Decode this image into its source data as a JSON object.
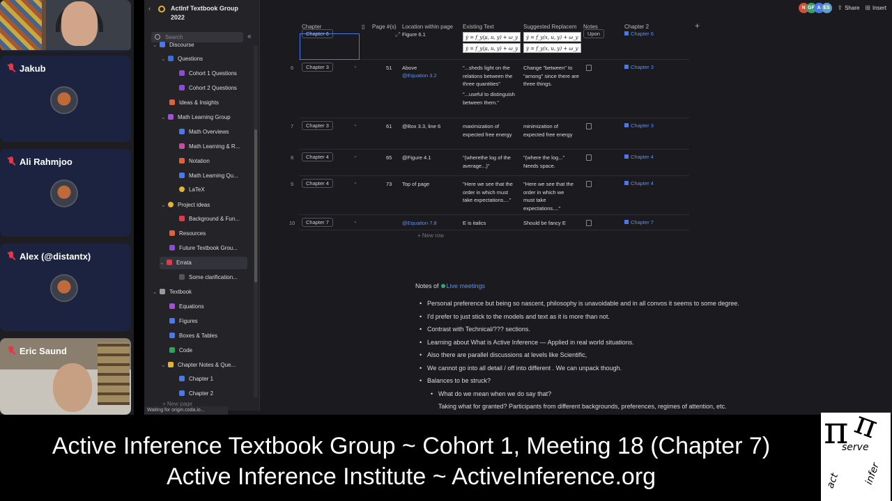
{
  "participants": [
    {
      "name": "Jakub",
      "muted": true
    },
    {
      "name": "Ali Rahmjoo",
      "muted": true
    },
    {
      "name": "Alex (@distantx)",
      "muted": true
    },
    {
      "name": "Eric Saund",
      "muted": true
    }
  ],
  "sidebar": {
    "doc_title": "ActInf Textbook Group 2022",
    "search_placeholder": "Search",
    "items": [
      {
        "label": "Discourse"
      },
      {
        "label": "Questions"
      },
      {
        "label": "Cohort 1 Questions"
      },
      {
        "label": "Cohort 2 Questions"
      },
      {
        "label": "Ideas & Insights"
      },
      {
        "label": "Math Learning Group"
      },
      {
        "label": "Math Overviews"
      },
      {
        "label": "Math Learning & R..."
      },
      {
        "label": "Notation"
      },
      {
        "label": "Math Learning Qu..."
      },
      {
        "label": "LaTeX"
      },
      {
        "label": "Project ideas"
      },
      {
        "label": "Background & Fun..."
      },
      {
        "label": "Resources"
      },
      {
        "label": "Future Textbook Grou..."
      },
      {
        "label": "Errata"
      },
      {
        "label": "Some clarification..."
      },
      {
        "label": "Textbook"
      },
      {
        "label": "Equations"
      },
      {
        "label": "Figures"
      },
      {
        "label": "Boxes & Tables"
      },
      {
        "label": "Code"
      },
      {
        "label": "Chapter Notes & Que..."
      },
      {
        "label": "Chapter 1"
      },
      {
        "label": "Chapter 2"
      }
    ],
    "new_page": "New page",
    "status": "Waiting for origin.coda.io..."
  },
  "topbar": {
    "avatars": [
      "N",
      "GF",
      "A",
      "ES"
    ],
    "share": "Share",
    "insert": "Insert"
  },
  "table": {
    "headers": [
      "Chapter",
      "Page #(s)",
      "Location within page",
      "Existing Text",
      "Suggested Replacem",
      "Notes",
      "Chapter 2"
    ],
    "rows": [
      {
        "num": "6",
        "chapter": "Chapter 3",
        "page": "51",
        "location": "Above",
        "location_link": "@Equation 3.2",
        "existing": "\"...sheds light on the relations between the three quantities\"",
        "existing2": "\"...useful to distinguish between them.\"",
        "suggested": "Change \"between\" to \"among\" since there are three things.",
        "chapter2": "Chapter 3"
      },
      {
        "num": "7",
        "chapter": "Chapter 3",
        "page": "61",
        "location": "@Box 3.3, line 6",
        "location_link": "",
        "existing": "maximization of expected free energy",
        "existing2": "",
        "suggested": "minimization of expected free energy",
        "chapter2": "Chapter 3"
      },
      {
        "num": "8",
        "chapter": "Chapter 4",
        "page": "65",
        "location": "@Figure 4.1",
        "location_link": "",
        "existing": "\"(wherethe log of the average...)\"",
        "existing2": "",
        "suggested": "\"(where the log...\" Needs space.",
        "chapter2": "Chapter 4"
      },
      {
        "num": "9",
        "chapter": "Chapter 4",
        "page": "73",
        "location": "Top of page",
        "location_link": "",
        "existing": "\"Here we see that the order in which must take expectations....\"",
        "existing2": "",
        "suggested": "\"Here we see that the order in which we must take expectations....\"",
        "chapter2": "Chapter 4"
      },
      {
        "num": "10",
        "chapter": "Chapter 7",
        "page": "",
        "location": "",
        "location_link": "@Equation 7.8",
        "existing": "E is italics",
        "existing2": "",
        "suggested": "Should be fancy E",
        "chapter2": "Chapter 7"
      }
    ],
    "partial_row": {
      "chapter": "Chapter 6",
      "location": "Figure 6.1",
      "eq1": "ẏ = f_y(μ, u, y) + ω_y",
      "eq2": "ẏ = f_y(x, u, y) + ω_y",
      "notes": "Upon",
      "chapter2": "Chapter 6"
    },
    "new_row": "New row"
  },
  "notes": {
    "prefix": "Notes of",
    "link": "Live meetings",
    "bullets": [
      "Personal preference but being so nascent, philosophy is unavoidable and in all convos it seems to some degree.",
      "I'd prefer to just stick to the models and text as it is more than not.",
      "Contrast with Technical/??? sections.",
      "Learning about What is Active Inference — Applied in real world situations.",
      "Also there are parallel discussions at levels like Scientific,",
      "We cannot go into all detail / off into different . We can unpack though.",
      "Balances to be struck?"
    ],
    "sub_bullets": [
      "What do we mean when we do say that?",
      "Taking what for granted? Participants from different backgrounds, preferences, regimes of attention, etc."
    ]
  },
  "caption": {
    "line1": "Active Inference Textbook Group ~ Cohort 1, Meeting 18 (Chapter 7)",
    "line2": "Active Inference Institute ~ ActiveInference.org"
  },
  "logo": {
    "words": [
      "serve",
      "act",
      "infer"
    ]
  }
}
